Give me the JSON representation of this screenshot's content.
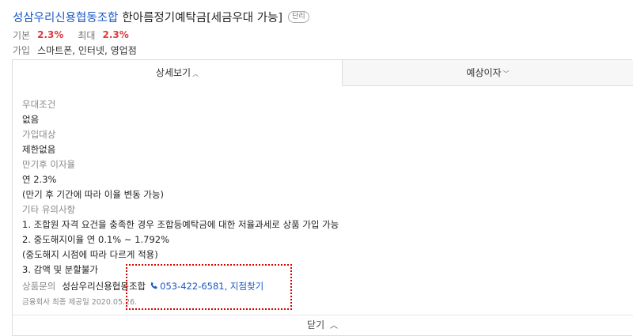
{
  "product": {
    "bank": "성삼우리신용협동조합",
    "name": "한아름정기예탁금[세금우대 가능]",
    "badge": "단리",
    "base_label": "기본",
    "base_rate": "2.3%",
    "max_label": "최대",
    "max_rate": "2.3%",
    "join_label": "가입",
    "join_value": "스마트폰, 인터넷, 영업점"
  },
  "tabs": [
    {
      "label": "상세보기",
      "icon": "chevron-up-icon",
      "active": true
    },
    {
      "label": "예상이자",
      "icon": "chevron-down-icon",
      "active": false
    }
  ],
  "details": {
    "preferential_label": "우대조건",
    "preferential_value": "없음",
    "target_label": "가입대상",
    "target_value": "제한없음",
    "maturity_label": "만기후 이자율",
    "maturity_line1": "연 2.3%",
    "maturity_line2": "(만기 후 기간에 따라 이율 변동 가능)",
    "notes_label": "기타 유의사항",
    "notes": [
      "1. 조합원 자격 요건을 충족한 경우 조합등예탁금에 대한 저율과세로 상품 가입 가능",
      "2. 중도해지이율 연 0.1% ~ 1.792%",
      "(중도해지 시점에 따라 다르게 적용)",
      "3. 감액 및 분할불가"
    ],
    "contact_label": "상품문의",
    "contact_bank": "성삼우리신용협동조합",
    "contact_phone": "053-422-6581, 지점찾기",
    "updated": "금융회사 최종 제공일 2020.05.26."
  },
  "close_label": "닫기",
  "colors": {
    "accent": "#1a57c4",
    "rate": "#e0393e",
    "highlight": "#e00000"
  }
}
